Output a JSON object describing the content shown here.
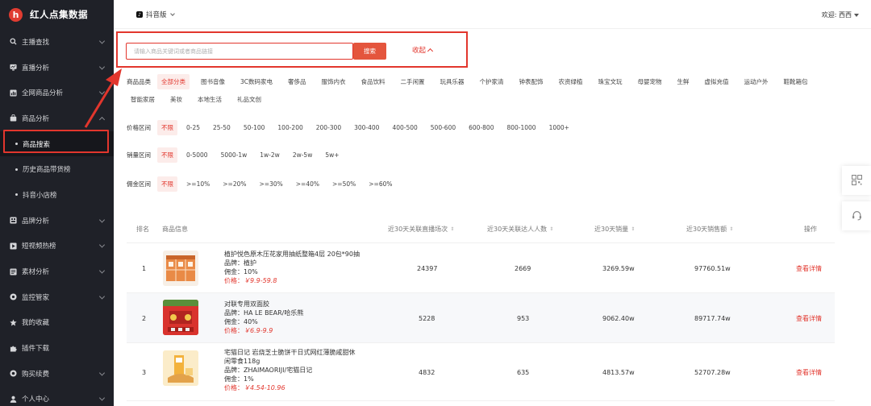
{
  "brand": {
    "logo_letter": "h",
    "name": "红人点集数据"
  },
  "sidebar": {
    "items": [
      {
        "label": "主播查找",
        "icon": "search-icon",
        "expanded": false
      },
      {
        "label": "直播分析",
        "icon": "monitor-icon",
        "expanded": false
      },
      {
        "label": "全网商品分析",
        "icon": "chart-icon",
        "expanded": false
      },
      {
        "label": "商品分析",
        "icon": "bag-icon",
        "expanded": true
      },
      {
        "label": "品牌分析",
        "icon": "brand-icon",
        "expanded": false
      },
      {
        "label": "短视频热榜",
        "icon": "video-icon",
        "expanded": false
      },
      {
        "label": "素材分析",
        "icon": "material-icon",
        "expanded": false
      },
      {
        "label": "监控管家",
        "icon": "monitor-eye-icon",
        "expanded": false
      },
      {
        "label": "我的收藏",
        "icon": "star-icon"
      },
      {
        "label": "插件下载",
        "icon": "puzzle-icon"
      },
      {
        "label": "购买续费",
        "icon": "coin-icon",
        "expanded": false
      },
      {
        "label": "个人中心",
        "icon": "user-icon",
        "expanded": false
      }
    ],
    "sub_items": [
      {
        "label": "商品搜索",
        "active": true
      },
      {
        "label": "历史商品带货榜",
        "active": false
      },
      {
        "label": "抖音小店榜",
        "active": false
      }
    ]
  },
  "topbar": {
    "platform": "抖音版",
    "welcome": "欢迎: 西西"
  },
  "search": {
    "placeholder": "请输入商品关键词或者商品链接",
    "button": "搜索",
    "collapse": "收起"
  },
  "filters": {
    "category_label": "商品品类",
    "categories": [
      "全部分类",
      "图书音像",
      "3C数码家电",
      "奢侈品",
      "服饰内衣",
      "食品饮料",
      "二手闲置",
      "玩具乐器",
      "个护家清",
      "钟表配饰",
      "农资绿植",
      "珠宝文玩",
      "母婴宠物",
      "生鲜",
      "虚拟充值",
      "运动户外",
      "鞋靴箱包",
      "智能家居",
      "美妆",
      "本地生活",
      "礼品文创"
    ],
    "price_label": "价格区间",
    "prices": [
      "不限",
      "0-25",
      "25-50",
      "50-100",
      "100-200",
      "200-300",
      "300-400",
      "400-500",
      "500-600",
      "600-800",
      "800-1000",
      "1000+"
    ],
    "sales_label": "销量区间",
    "sales": [
      "不限",
      "0-5000",
      "5000-1w",
      "1w-2w",
      "2w-5w",
      "5w+"
    ],
    "commission_label": "佣金区间",
    "commissions": [
      "不限",
      ">=10%",
      ">=20%",
      ">=30%",
      ">=40%",
      ">=50%",
      ">=60%"
    ]
  },
  "table": {
    "headers": {
      "rank": "排名",
      "info": "商品信息",
      "live": "近30天关联直播场次",
      "kol": "近30天关联达人人数",
      "sales": "近30天销量",
      "revenue": "近30天销售额",
      "action": "操作"
    },
    "rows": [
      {
        "rank": "1",
        "title": "植护悦色原木压花家用抽纸整箱4层 20包*90抽",
        "title2": "",
        "brand": "品牌：植护",
        "commission": "佣金：10%",
        "price_prefix": "价格：",
        "price": "￥9.9-59.8",
        "live": "24397",
        "kol": "2669",
        "sales": "3269.59w",
        "revenue": "97760.51w",
        "action": "查看详情"
      },
      {
        "rank": "2",
        "title": "对联专用双面胶",
        "title2": "",
        "brand": "品牌：HA LE BEAR/哈乐熊",
        "commission": "佣金：40%",
        "price_prefix": "价格：",
        "price": "￥6.9-9.9",
        "live": "5228",
        "kol": "953",
        "sales": "9062.40w",
        "revenue": "89717.74w",
        "action": "查看详情"
      },
      {
        "rank": "3",
        "title": "宅猫日记 岩烧芝士脆饼干日式网红薄脆咸甜休",
        "title2": "闲零食118g",
        "brand": "品牌：ZHAIMAORIJI/宅猫日记",
        "commission": "佣金：1%",
        "price_prefix": "价格：",
        "price": "￥4.54-10.96",
        "live": "4832",
        "kol": "635",
        "sales": "4813.57w",
        "revenue": "52707.28w",
        "action": "查看详情"
      }
    ]
  },
  "colors": {
    "accent": "#e2362d",
    "sidebar_bg": "#1f2128"
  }
}
